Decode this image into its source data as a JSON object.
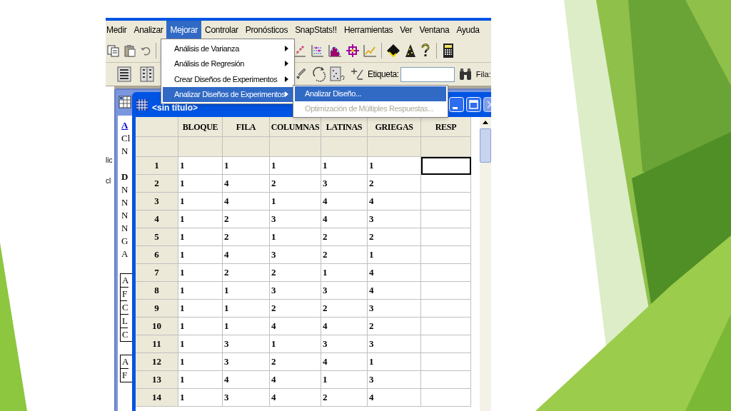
{
  "menu_bar": [
    {
      "label": "Medir",
      "selected": false
    },
    {
      "label": "Analizar",
      "selected": false
    },
    {
      "label": "Mejorar",
      "selected": true
    },
    {
      "label": "Controlar",
      "selected": false
    },
    {
      "label": "Pronósticos",
      "selected": false
    },
    {
      "label": "SnapStats!!",
      "selected": false
    },
    {
      "label": "Herramientas",
      "selected": false
    },
    {
      "label": "Ver",
      "selected": false
    },
    {
      "label": "Ventana",
      "selected": false
    },
    {
      "label": "Ayuda",
      "selected": false
    }
  ],
  "menu": {
    "items": [
      {
        "label": "Análisis de Varianza",
        "has_submenu": true,
        "selected": false
      },
      {
        "label": "Análisis de Regresión",
        "has_submenu": true,
        "selected": false
      },
      {
        "label": "Crear Diseños de Experimentos",
        "has_submenu": true,
        "selected": false
      },
      {
        "label": "Analizar Diseños de Experimentos",
        "has_submenu": true,
        "selected": true
      }
    ]
  },
  "submenu": {
    "items": [
      {
        "label": "Analizar Diseño...",
        "selected": true,
        "disabled": false
      },
      {
        "label": "Optimización de Múltiples Respuestas...",
        "selected": false,
        "disabled": true
      }
    ]
  },
  "toolbar": {
    "label_field": {
      "label": "Etiqueta:"
    },
    "row_label": "Fila:"
  },
  "side_texts": [
    "lic",
    "cl"
  ],
  "back_window": {
    "groups": [
      {
        "boxed": false,
        "items": [
          {
            "text": "A",
            "kind": "link"
          },
          {
            "text": "Cl",
            "kind": "plain"
          },
          {
            "text": "N",
            "kind": "plain"
          }
        ]
      },
      {
        "boxed": false,
        "items": [
          {
            "text": "D",
            "kind": "bold"
          },
          {
            "text": "N",
            "kind": "plain"
          },
          {
            "text": "N",
            "kind": "plain"
          },
          {
            "text": "N",
            "kind": "plain"
          },
          {
            "text": "N",
            "kind": "plain"
          },
          {
            "text": "G",
            "kind": "plain"
          },
          {
            "text": "A",
            "kind": "plain"
          }
        ]
      },
      {
        "boxed": true,
        "items": [
          {
            "text": "A",
            "kind": "plain"
          },
          {
            "text": "F",
            "kind": "plain"
          },
          {
            "text": "C",
            "kind": "plain"
          },
          {
            "text": "L",
            "kind": "plain"
          },
          {
            "text": "C",
            "kind": "plain"
          }
        ]
      },
      {
        "boxed": true,
        "items": [
          {
            "text": "A",
            "kind": "plain"
          },
          {
            "text": "F",
            "kind": "plain"
          }
        ]
      }
    ]
  },
  "data_window": {
    "title": "<sin título>",
    "table": {
      "columns": [
        "BLOQUE",
        "FILA",
        "COLUMNAS",
        "LATINAS",
        "GRIEGAS",
        "RESP"
      ],
      "rows": [
        {
          "label": "1",
          "cells": [
            "1",
            "1",
            "1",
            "1",
            "1"
          ],
          "selected": true
        },
        {
          "label": "2",
          "cells": [
            "1",
            "4",
            "2",
            "3",
            "2"
          ],
          "selected": false
        },
        {
          "label": "3",
          "cells": [
            "1",
            "4",
            "1",
            "4",
            "4"
          ],
          "selected": false
        },
        {
          "label": "4",
          "cells": [
            "1",
            "2",
            "3",
            "4",
            "3"
          ],
          "selected": false
        },
        {
          "label": "5",
          "cells": [
            "1",
            "2",
            "1",
            "2",
            "2"
          ],
          "selected": false
        },
        {
          "label": "6",
          "cells": [
            "1",
            "4",
            "3",
            "2",
            "1"
          ],
          "selected": false
        },
        {
          "label": "7",
          "cells": [
            "1",
            "2",
            "2",
            "1",
            "4"
          ],
          "selected": false
        },
        {
          "label": "8",
          "cells": [
            "1",
            "1",
            "3",
            "3",
            "4"
          ],
          "selected": false
        },
        {
          "label": "9",
          "cells": [
            "1",
            "1",
            "2",
            "2",
            "3"
          ],
          "selected": false
        },
        {
          "label": "10",
          "cells": [
            "1",
            "1",
            "4",
            "4",
            "2"
          ],
          "selected": false
        },
        {
          "label": "11",
          "cells": [
            "1",
            "3",
            "1",
            "3",
            "3"
          ],
          "selected": false
        },
        {
          "label": "12",
          "cells": [
            "1",
            "3",
            "2",
            "4",
            "1"
          ],
          "selected": false
        },
        {
          "label": "13",
          "cells": [
            "1",
            "4",
            "4",
            "1",
            "3"
          ],
          "selected": false
        },
        {
          "label": "14",
          "cells": [
            "1",
            "3",
            "4",
            "2",
            "4"
          ],
          "selected": false
        }
      ]
    }
  }
}
